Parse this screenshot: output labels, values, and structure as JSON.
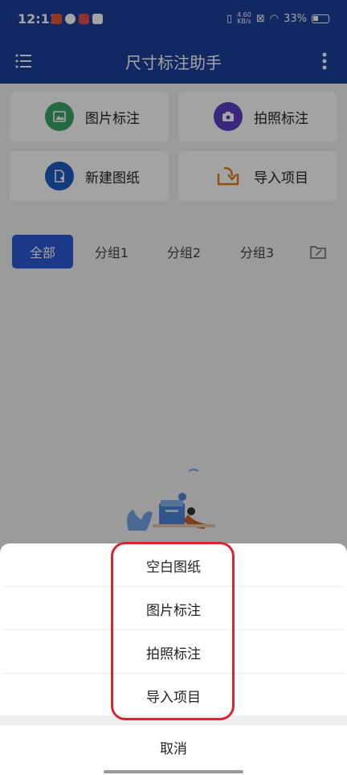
{
  "status_bar": {
    "time": "12:11",
    "net_speed_value": "4.60",
    "net_speed_unit": "KB/s",
    "battery": "33%"
  },
  "app_bar": {
    "title": "尺寸标注助手",
    "menu_icon": "list-menu-icon",
    "more_icon": "more-vertical-icon"
  },
  "actions": [
    {
      "label": "图片标注",
      "icon": "image-icon",
      "color": "#3aa569"
    },
    {
      "label": "拍照标注",
      "icon": "camera-icon",
      "color": "#5b3fc4"
    },
    {
      "label": "新建图纸",
      "icon": "new-drawing-icon",
      "color": "#1f5bc4"
    },
    {
      "label": "导入项目",
      "icon": "import-icon",
      "color": "#e07a1f"
    }
  ],
  "tabs": [
    {
      "label": "全部",
      "active": true
    },
    {
      "label": "分组1",
      "active": false
    },
    {
      "label": "分组2",
      "active": false
    },
    {
      "label": "分组3",
      "active": false
    }
  ],
  "folder_icon": "folder-edit-icon",
  "sheet": {
    "items": [
      "空白图纸",
      "图片标注",
      "拍照标注",
      "导入项目"
    ],
    "cancel": "取消"
  },
  "colors": {
    "primary": "#1c3f9c",
    "tab_active": "#2a5bd7",
    "highlight": "#d9252f"
  }
}
